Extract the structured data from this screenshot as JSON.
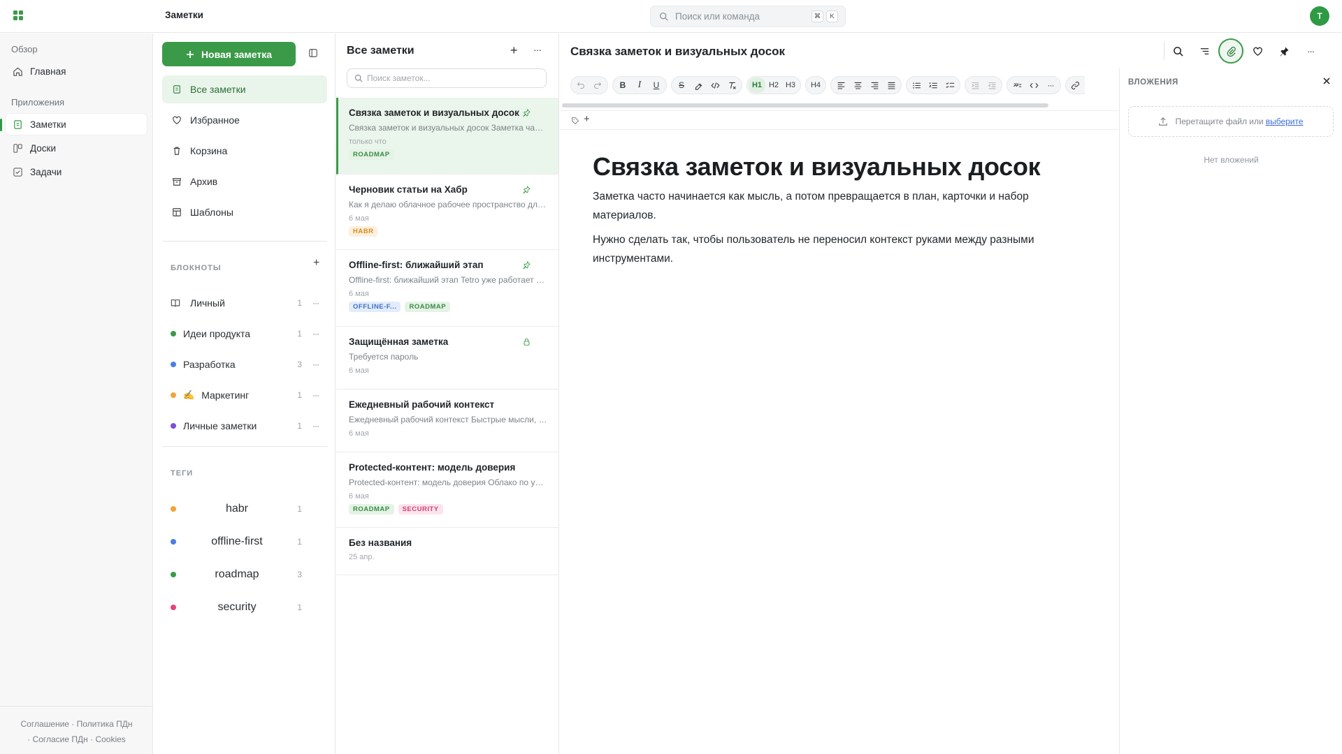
{
  "topbar": {
    "breadcrumb": "Заметки",
    "search_placeholder": "Поиск или команда",
    "shortcut_mod": "⌘",
    "shortcut_key": "K",
    "avatar_letter": "T"
  },
  "nav": {
    "section_overview": "Обзор",
    "home": "Главная",
    "section_apps": "Приложения",
    "notes": "Заметки",
    "boards": "Доски",
    "tasks": "Задачи",
    "footer_links": [
      "Соглашение",
      "Политика ПДн",
      "Согласие ПДн",
      "Cookies"
    ],
    "footer_sep": "·"
  },
  "panel": {
    "new_note_label": "Новая заметка",
    "items": [
      "Все заметки",
      "Избранное",
      "Корзина",
      "Архив",
      "Шаблоны"
    ],
    "notebooks_title": "БЛОКНОТЫ",
    "notebooks": [
      {
        "name": "Личный",
        "count": "1",
        "icon": "book-icon"
      },
      {
        "name": "Идеи продукта",
        "count": "1",
        "color": "#3a9a48"
      },
      {
        "name": "Разработка",
        "count": "3",
        "color": "#4a7fe0"
      },
      {
        "name": "Маркетинг",
        "count": "1",
        "color": "#f0a43a",
        "emoji": "✍️"
      },
      {
        "name": "Личные заметки",
        "count": "1",
        "color": "#7a4fd6"
      }
    ],
    "tags_title": "ТЕГИ",
    "tags": [
      {
        "name": "habr",
        "count": "1",
        "color": "#f0a43a"
      },
      {
        "name": "offline-first",
        "count": "1",
        "color": "#4a7fe0"
      },
      {
        "name": "roadmap",
        "count": "3",
        "color": "#3a9a48"
      },
      {
        "name": "security",
        "count": "1",
        "color": "#e0457a"
      }
    ],
    "more": "···",
    "add": "+"
  },
  "notes": {
    "title": "Все заметки",
    "search_placeholder": "Поиск заметок...",
    "add": "+",
    "more": "···",
    "list": [
      {
        "title": "Связка заметок и визуальных досок",
        "preview": "Связка заметок и визуальных досок Заметка часто начинается",
        "date": "только что",
        "tags": [
          "ROADMAP"
        ],
        "icon": "pin"
      },
      {
        "title": "Черновик статьи на Хабр",
        "preview": "Как я делаю облачное рабочее пространство для заметок",
        "date": "6 мая",
        "tags": [
          "HABR"
        ],
        "icon": "pin"
      },
      {
        "title": "Offline-first: ближайший этап",
        "preview": "Offline-first: ближайший этап Tetro уже работает в браузере",
        "date": "6 мая",
        "tags": [
          "OFFLINE-F...",
          "ROADMAP"
        ],
        "icon": "pin"
      },
      {
        "title": "Защищённая заметка",
        "preview": "Требуется пароль",
        "date": "6 мая",
        "tags": [],
        "icon": "lock"
      },
      {
        "title": "Ежедневный рабочий контекст",
        "preview": "Ежедневный рабочий контекст Быстрые мысли, задачи и ссылки",
        "date": "6 мая",
        "tags": [],
        "icon": ""
      },
      {
        "title": "Protected-контент: модель доверия",
        "preview": "Protected-контент: модель доверия Облако по умолчанию",
        "date": "6 мая",
        "tags": [
          "ROADMAP",
          "SECURITY"
        ],
        "icon": ""
      },
      {
        "title": "Без названия",
        "preview": "",
        "date": "25 апр.",
        "tags": [],
        "icon": ""
      }
    ]
  },
  "chip_colors": {
    "ROADMAP": [
      "#e4f3e5",
      "#3a8a44"
    ],
    "HABR": [
      "#fdf0de",
      "#d88a1e"
    ],
    "OFFLINE-F...": [
      "#e3ecfb",
      "#3f6fc8"
    ],
    "SECURITY": [
      "#fce4ec",
      "#d43f73"
    ]
  },
  "editor": {
    "title": "Связка заметок и визуальных досок",
    "doc_heading": "Связка заметок и визуальных досок",
    "paragraph_1": "Заметка часто начинается как мысль, а потом превращается в план, карточки и набор материалов.",
    "paragraph_2": "Нужно сделать так, чтобы пользователь не переносил контекст руками между разными инструментами.",
    "tag_add": "+",
    "toolbar": {
      "bold": "B",
      "italic": "I",
      "underline": "U",
      "strike": "S",
      "h1": "H1",
      "h2": "H2",
      "h3": "H3",
      "h4": "H4",
      "more": "···"
    }
  },
  "attachments": {
    "title": "ВЛОЖЕНИЯ",
    "drop_text": "Перетащите файл или",
    "drop_link": "выберите",
    "empty": "Нет вложений"
  },
  "colors": {
    "accent": "#3a9a48"
  }
}
